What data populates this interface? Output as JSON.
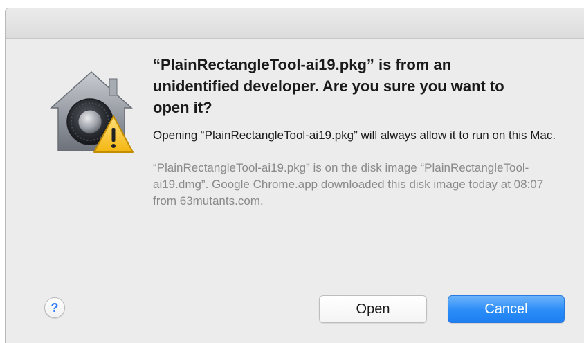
{
  "dialog": {
    "icon": "gatekeeper-lock-warning-icon",
    "headline": "“PlainRectangleTool-ai19.pkg” is from an unidentified developer. Are you sure you want to open it?",
    "body": "Opening “PlainRectangleTool-ai19.pkg” will always allow it to run on this Mac.",
    "detail": "“PlainRectangleTool-ai19.pkg” is on the disk image “PlainRectangleTool-ai19.dmg”. Google Chrome.app downloaded this disk image today at 08:07 from 63mutants.com.",
    "help_label": "?",
    "open_label": "Open",
    "cancel_label": "Cancel"
  },
  "colors": {
    "accent": "#2a8cf7",
    "dialog_background": "#ececec",
    "detail_text": "#8a8a8a"
  }
}
